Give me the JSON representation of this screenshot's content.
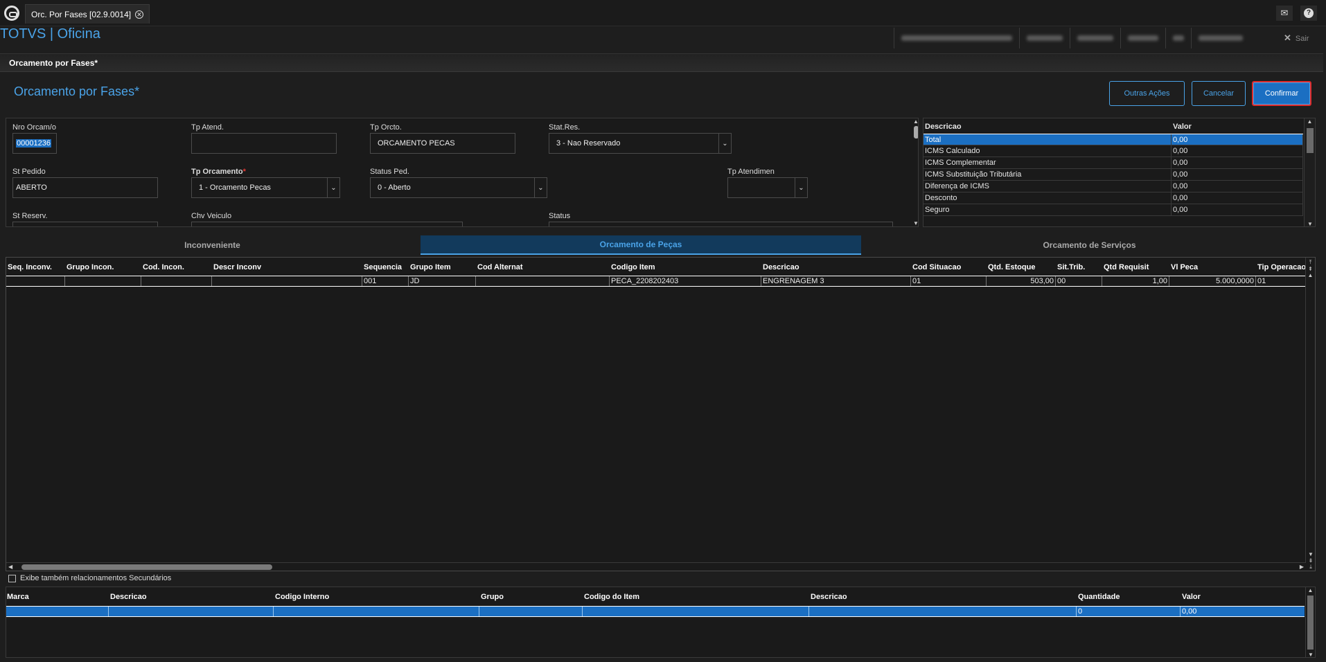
{
  "tabbar": {
    "tab_label": "Orc. Por Fases [02.9.0014]",
    "close_glyph": "✕",
    "mail_glyph": "✉",
    "help_glyph": "?"
  },
  "header": {
    "app_title": "TOTVS | Oficina",
    "logout_label": "Sair",
    "logout_glyph": "✕"
  },
  "breadcrumb": "Orcamento por Fases*",
  "page": {
    "title": "Orcamento por Fases*",
    "buttons": {
      "outras": "Outras Ações",
      "cancelar": "Cancelar",
      "confirmar": "Confirmar"
    }
  },
  "form": {
    "nro_orcam": {
      "label": "Nro Orcam/o",
      "value": "00001236"
    },
    "tp_atend": {
      "label": "Tp Atend.",
      "value": ""
    },
    "tp_orcto": {
      "label": "Tp Orcto.",
      "value": "ORCAMENTO PECAS"
    },
    "stat_res": {
      "label": "Stat.Res.",
      "value": "3 - Nao Reservado"
    },
    "st_pedido": {
      "label": "St Pedido",
      "value": "ABERTO"
    },
    "tp_orcamento": {
      "label": "Tp Orcamento",
      "required": "*",
      "value": "1 - Orcamento Pecas"
    },
    "status_ped": {
      "label": "Status Ped.",
      "value": "0 - Aberto"
    },
    "tp_atendimen": {
      "label": "Tp Atendimen",
      "value": ""
    },
    "st_reserv": {
      "label": "St Reserv."
    },
    "chv_veiculo": {
      "label": "Chv Veiculo"
    },
    "status": {
      "label": "Status"
    }
  },
  "summary": {
    "headers": {
      "descricao": "Descricao",
      "valor": "Valor"
    },
    "rows": [
      {
        "descricao": "Total",
        "valor": "0,00"
      },
      {
        "descricao": "ICMS Calculado",
        "valor": "0,00"
      },
      {
        "descricao": "ICMS Complementar",
        "valor": "0,00"
      },
      {
        "descricao": "ICMS Substituição Tributária",
        "valor": "0,00"
      },
      {
        "descricao": "Diferença de ICMS",
        "valor": "0,00"
      },
      {
        "descricao": "Desconto",
        "valor": "0,00"
      },
      {
        "descricao": "Seguro",
        "valor": "0,00"
      }
    ]
  },
  "tabs": {
    "inconveniente": "Inconveniente",
    "pecas": "Orcamento de Peças",
    "servicos": "Orcamento de Serviços"
  },
  "grid": {
    "headers": [
      "Seq. Inconv.",
      "Grupo Incon.",
      "Cod. Incon.",
      "Descr Inconv",
      "Sequencia",
      "Grupo Item",
      "Cod Alternat",
      "Codigo Item",
      "Descricao",
      "Cod Situacao",
      "Qtd. Estoque",
      "Sit.Trib.",
      "Qtd Requisit",
      "Vl Peca",
      "Tip Operacao"
    ],
    "rows": [
      [
        "",
        "",
        "",
        "",
        "001",
        "JD",
        "",
        "PECA_2208202403",
        "ENGRENAGEM 3",
        "01",
        "503,00",
        "00",
        "1,00",
        "5.000,0000",
        "01"
      ]
    ]
  },
  "checkbox_label": "Exibe também relacionamentos Secundários",
  "bottom_grid": {
    "headers": [
      "Marca",
      "Descricao",
      "Codigo Interno",
      "Grupo",
      "Codigo do Item",
      "Descricao",
      "Quantidade",
      "Valor"
    ],
    "rows": [
      [
        "",
        "",
        "",
        "",
        "",
        "",
        "0",
        "0,00"
      ]
    ]
  },
  "colors": {
    "accent": "#4aa3e8",
    "selection": "#1b6fc2",
    "confirm_border": "#e02a2a"
  }
}
